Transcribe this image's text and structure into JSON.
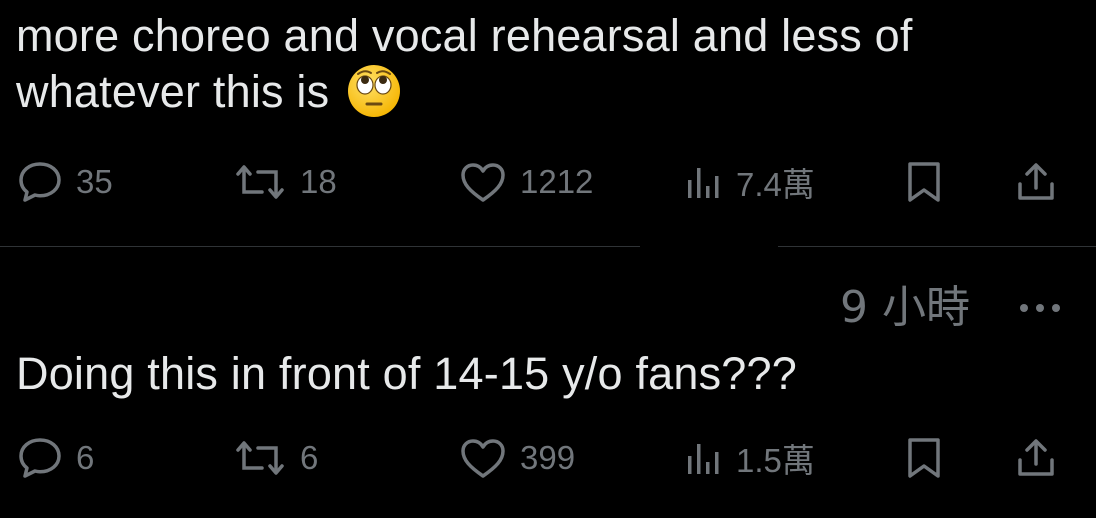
{
  "tweets": [
    {
      "text": "more choreo and vocal rehearsal and less of whatever this is",
      "emoji": "face-with-rolling-eyes",
      "actions": {
        "replies": "35",
        "retweets": "18",
        "likes": "1212",
        "views": "7.4萬"
      }
    },
    {
      "timestamp": "9 小時",
      "text": "Doing this in front of 14-15 y/o fans???",
      "actions": {
        "replies": "6",
        "retweets": "6",
        "likes": "399",
        "views": "1.5萬"
      }
    }
  ],
  "icons": {
    "reply": "reply-icon",
    "retweet": "retweet-icon",
    "like": "heart-icon",
    "views": "views-icon",
    "bookmark": "bookmark-icon",
    "share": "share-icon",
    "more": "more-icon"
  },
  "colors": {
    "background": "#000000",
    "text": "#e7e9ea",
    "secondary": "#71767b",
    "divider": "#2f3336",
    "emoji": "#ffcc33"
  }
}
